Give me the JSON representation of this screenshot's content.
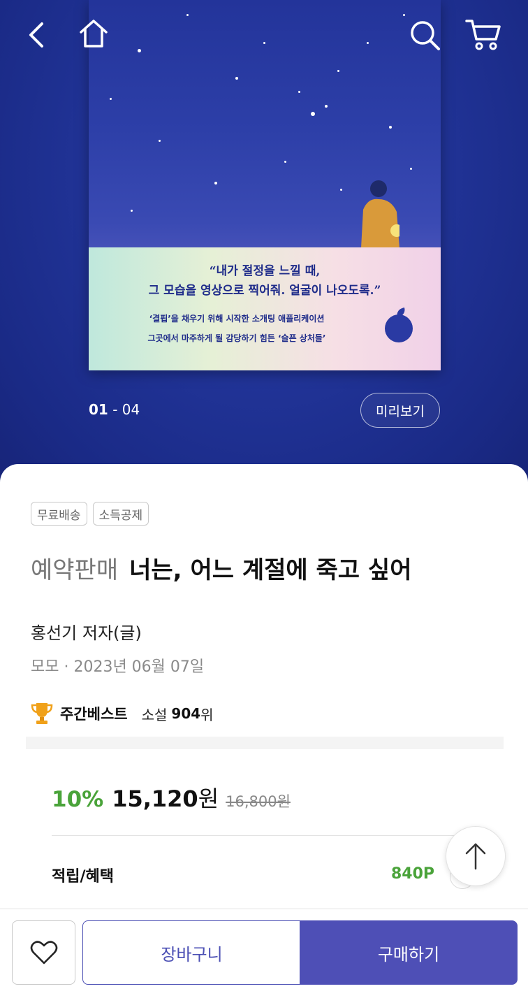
{
  "cover": {
    "quote_line1": "“내가 절정을 느낄 때,",
    "quote_line2": "그 모습을 영상으로 찍어줘. 얼굴이 나오도록.”",
    "sub_line1": "‘결핍’을 채우기 위해 시작한 소개팅 애플리케이션",
    "sub_line2": "그곳에서 마주하게 될 감당하기 힘든 ‘슬픈 상처들’"
  },
  "topbar": {
    "back_icon": "chevron-left-icon",
    "home_icon": "home-icon",
    "search_icon": "search-icon",
    "cart_icon": "cart-icon"
  },
  "gallery": {
    "current": "01",
    "separator": " - ",
    "total": "04",
    "preview_label": "미리보기"
  },
  "product": {
    "tags": [
      "무료배송",
      "소득공제"
    ],
    "preorder_label": "예약판매",
    "title": "너는, 어느 계절에 죽고 싶어",
    "author": "홍선기 저자(글)",
    "publisher_date": "모모 · 2023년 06월 07일",
    "best_label": "주간베스트",
    "best_category": "소설",
    "best_rank": "904",
    "best_rank_suffix": "위"
  },
  "price": {
    "discount": "10%",
    "sale_price": "15,120",
    "sale_unit": "원",
    "original_price": "16,800원",
    "points_label": "적립/혜택",
    "points_value": "840P"
  },
  "actions": {
    "cart_label": "장바구니",
    "buy_label": "구매하기"
  },
  "colors": {
    "accent_green": "#4aa33a",
    "brand_purple": "#4e4fb6",
    "hero_blue": "#1b2a86"
  }
}
